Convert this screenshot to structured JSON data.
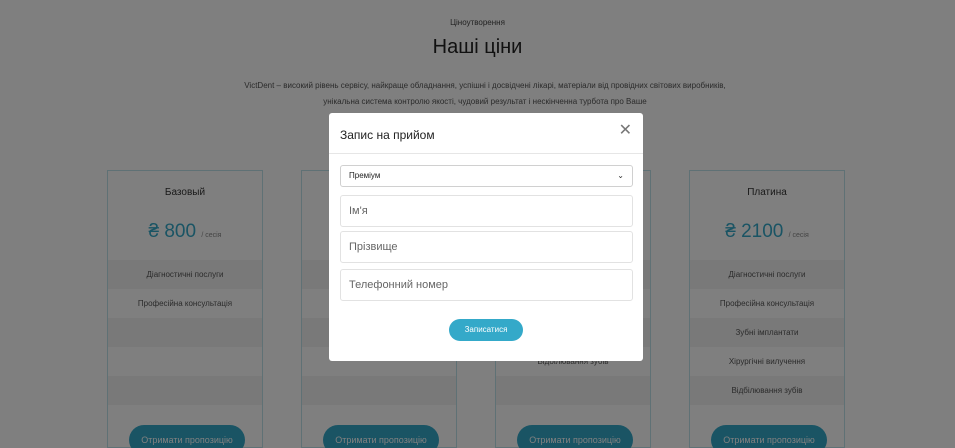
{
  "section": {
    "eyebrow": "Ціноутворення",
    "title": "Наші ціни",
    "description": "VictDent – високий рівень сервісу, найкраще обладнання, успішні і досвідчені лікарі, матеріали від провідних світових виробників, унікальна система контролю якості, чудовий результат і нескінченна турбота про Ваше"
  },
  "cards": [
    {
      "plan": "Базовый",
      "currency": "₴",
      "price": "800",
      "per": "/ сесія",
      "features": [
        "Діагностичні послуги",
        "Професійна консультація",
        "",
        "",
        ""
      ],
      "button": "Отримати пропозицію"
    },
    {
      "plan": "",
      "currency": "",
      "price": "",
      "per": "",
      "features": [
        "",
        "",
        "",
        "",
        ""
      ],
      "button": "Отримати пропозицію"
    },
    {
      "plan": "",
      "currency": "",
      "price": "",
      "per": "",
      "features": [
        "",
        "",
        "",
        "Відбілювання зубів",
        ""
      ],
      "button": "Отримати пропозицію"
    },
    {
      "plan": "Платина",
      "currency": "₴",
      "price": "2100",
      "per": "/ сесія",
      "features": [
        "Діагностичні послуги",
        "Професійна консультація",
        "Зубні імплантати",
        "Хірургічні вилучення",
        "Відбілювання зубів"
      ],
      "button": "Отримати пропозицію"
    }
  ],
  "modal": {
    "title": "Запис на прийом",
    "close_icon": "close-icon",
    "select_value": "Преміум",
    "first_name_placeholder": "Ім'я",
    "last_name_placeholder": "Прізвище",
    "phone_placeholder": "Телефонний номер",
    "submit": "Записатися"
  },
  "colors": {
    "accent": "#34a9c9",
    "overlay": "rgba(0,0,0,0.5)"
  }
}
